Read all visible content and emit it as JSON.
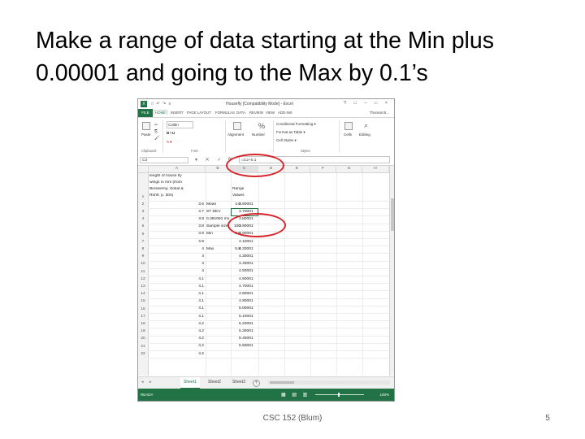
{
  "slide": {
    "title_line1": "Make a range of data starting at the Min plus",
    "title_line2": "0.00001 and going to the Max by 0.1’s",
    "footer": "CSC 152 (Blum)",
    "page_number": "5"
  },
  "excel": {
    "app_icon": "X",
    "qat": "□ ↶ ↷ ≡",
    "window_title": "Housefly  [Compatibility Mode]  -  Excel",
    "window_controls": "? □ – □ ×",
    "tabs": [
      "FILE",
      "HOME",
      "INSERT",
      "PAGE LAYOUT",
      "FORMULAS",
      "DATA",
      "REVIEW",
      "VIEW",
      "ADD-INS"
    ],
    "user": "Thomas B...",
    "ribbon": {
      "paste": "Paste",
      "font_name": "Calibri",
      "font_format": "B  I  U",
      "alignment": "Alignment",
      "number": "Number",
      "cond_format": "Conditional Formatting ▾",
      "format_table": "Format as Table ▾",
      "cell_styles": "Cell Styles ▾",
      "cells": "Cells",
      "editing": "Editing",
      "group_clipboard": "Clipboard",
      "group_font": "Font",
      "group_styles": "Styles"
    },
    "name_box": "C3",
    "fx_buttons": "▾  ✕  ✓",
    "fx_label": "fx",
    "formula": "=C2+0.1",
    "columns": [
      "A",
      "B",
      "C",
      "D",
      "E",
      "F",
      "G",
      "H"
    ],
    "cells": {
      "a_header": [
        "length of house fly",
        "wings in mm (from",
        "Bioswerny, Sokal &",
        "Rohlf, p. 304)"
      ],
      "c_header": [
        "Range",
        "Values"
      ],
      "row_numbers": [
        "1",
        "2",
        "3",
        "4",
        "5",
        "6",
        "7",
        "8",
        "9",
        "10",
        "11",
        "12",
        "13",
        "14",
        "15",
        "16",
        "17",
        "18",
        "19",
        "20",
        "21",
        "22"
      ],
      "col_a": [
        "3.6",
        "3.7",
        "3.8",
        "3.8",
        "3.9",
        "3.9",
        "4",
        "4",
        "4",
        "4",
        "4.1",
        "4.1",
        "4.1",
        "4.1",
        "4.1",
        "4.1",
        "4.2",
        "4.2",
        "4.2",
        "4.2",
        "4.2"
      ],
      "col_b_labels": [
        "Mean",
        "ST DEV",
        "0.391061 ms",
        "Sample size",
        "Min",
        "",
        "Max"
      ],
      "col_b_values": [
        "4.6",
        "",
        "",
        "100",
        "3.6",
        "",
        "5.5"
      ],
      "col_c": [
        "3.60001",
        "3.70001",
        "3.80001",
        "3.90001",
        "4.00001",
        "4.10001",
        "4.20001",
        "4.30001",
        "4.40001",
        "4.50001",
        "4.60001",
        "4.70001",
        "4.80001",
        "4.90001",
        "5.00001",
        "5.10001",
        "5.20001",
        "5.30001",
        "5.40001",
        "5.50001"
      ]
    },
    "sheets": [
      "Sheet1",
      "Sheet2",
      "Sheet3"
    ],
    "sheet_nav": "◂ ▸",
    "sheet_add": "+",
    "status": "READY",
    "status_views": "▦ ▤ ▥",
    "zoom": "100%"
  }
}
